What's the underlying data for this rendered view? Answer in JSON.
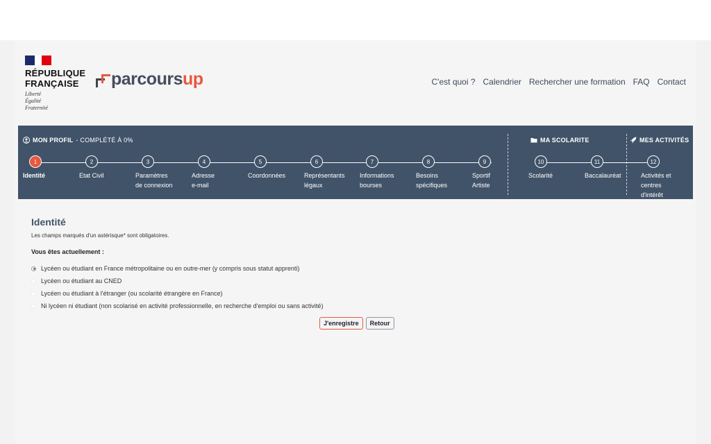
{
  "header": {
    "republic_line1": "RÉPUBLIQUE",
    "republic_line2": "FRANÇAISE",
    "motto_1": "Liberté",
    "motto_2": "Égalité",
    "motto_3": "Fraternité",
    "brand_left": "parcours",
    "brand_right": "up",
    "nav": [
      "C'est quoi ?",
      "Calendrier",
      "Rechercher une formation",
      "FAQ",
      "Contact"
    ]
  },
  "progress": {
    "profile_label": "MON PROFIL",
    "profile_status": "- COMPLÉTÉ À 0%",
    "scolarite_label": "MA SCOLARITE",
    "activites_label": "MES ACTIVITÉS",
    "steps": [
      {
        "num": "1",
        "line1": "Identité",
        "line2": "",
        "line3": ""
      },
      {
        "num": "2",
        "line1": "Etat Civil",
        "line2": "",
        "line3": ""
      },
      {
        "num": "3",
        "line1": "Paramètres",
        "line2": "de connexion",
        "line3": ""
      },
      {
        "num": "4",
        "line1": "Adresse",
        "line2": "e-mail",
        "line3": ""
      },
      {
        "num": "5",
        "line1": "Coordonnées",
        "line2": "",
        "line3": ""
      },
      {
        "num": "6",
        "line1": "Représentants",
        "line2": "légaux",
        "line3": ""
      },
      {
        "num": "7",
        "line1": "Informations",
        "line2": "bourses",
        "line3": ""
      },
      {
        "num": "8",
        "line1": "Besoins",
        "line2": "spécifiques",
        "line3": ""
      },
      {
        "num": "9",
        "line1": "Sportif",
        "line2": "Artiste",
        "line3": ""
      },
      {
        "num": "10",
        "line1": "Scolarité",
        "line2": "",
        "line3": ""
      },
      {
        "num": "11",
        "line1": "Baccalauréat",
        "line2": "",
        "line3": ""
      },
      {
        "num": "12",
        "line1": "Activités et",
        "line2": "centres",
        "line3": "d'intérêt"
      }
    ],
    "active_step": 1
  },
  "form": {
    "title": "Identité",
    "hint": "Les champs marqués d'un astérisque* sont obligatoires.",
    "question": "Vous êtes actuellement :",
    "options": [
      "Lycéen ou étudiant en France métropolitaine ou en outre-mer (y compris sous statut apprenti)",
      "Lycéen ou étudiant au CNED",
      "Lycéen ou étudiant à l'étranger (ou scolarité étrangère en France)",
      "Ni lycéen ni étudiant (non scolarisé en activité professionnelle, en recherche d'emploi ou sans activité)"
    ],
    "selected_option": 0,
    "save_label": "J'enregistre",
    "back_label": "Retour"
  },
  "colors": {
    "band": "#415369",
    "accent": "#e8573f",
    "title": "#415369"
  }
}
